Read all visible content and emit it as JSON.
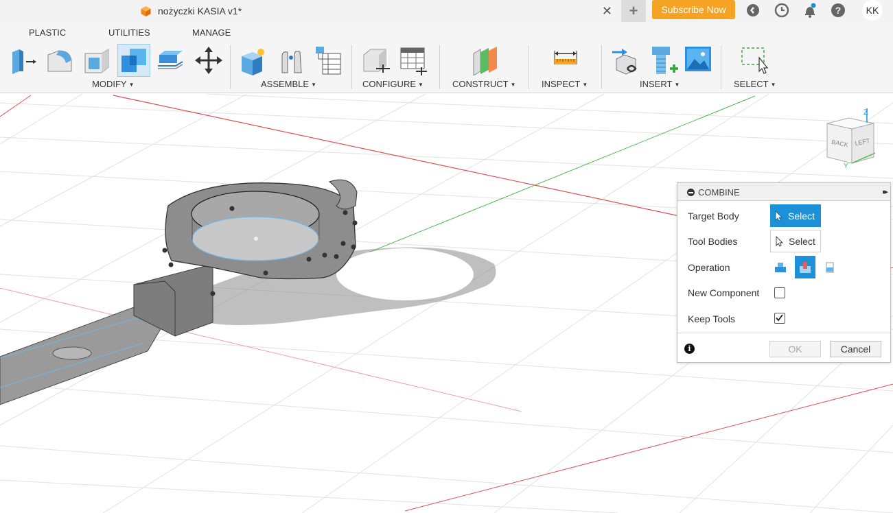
{
  "titlebar": {
    "doc_title": "nożyczki KASIA v1*",
    "close_glyph": "✕",
    "new_tab_glyph": "+",
    "subscribe_label": "Subscribe Now",
    "user_initials": "KK"
  },
  "ribbon": {
    "tabs": [
      "PLASTIC",
      "UTILITIES",
      "MANAGE"
    ],
    "groups": {
      "modify": "MODIFY",
      "assemble": "ASSEMBLE",
      "configure": "CONFIGURE",
      "construct": "CONSTRUCT",
      "inspect": "INSPECT",
      "insert": "INSERT",
      "select": "SELECT"
    },
    "caret": "▼"
  },
  "viewcube": {
    "back": "BACK",
    "left": "LEFT",
    "z": "Z",
    "y": "Y"
  },
  "combine_panel": {
    "title": "COMBINE",
    "expand_glyph": "▸▸",
    "target_body_label": "Target Body",
    "target_body_button": "Select",
    "tool_bodies_label": "Tool Bodies",
    "tool_bodies_button": "Select",
    "operation_label": "Operation",
    "operation_selected": "cut",
    "new_component_label": "New Component",
    "new_component_checked": false,
    "keep_tools_label": "Keep Tools",
    "keep_tools_checked": true,
    "info_glyph": "i",
    "ok_label": "OK",
    "cancel_label": "Cancel"
  },
  "colors": {
    "accent": "#1d91d8",
    "subscribe": "#f5a323",
    "axis_red": "#e05050",
    "axis_green": "#4cbb4c"
  }
}
